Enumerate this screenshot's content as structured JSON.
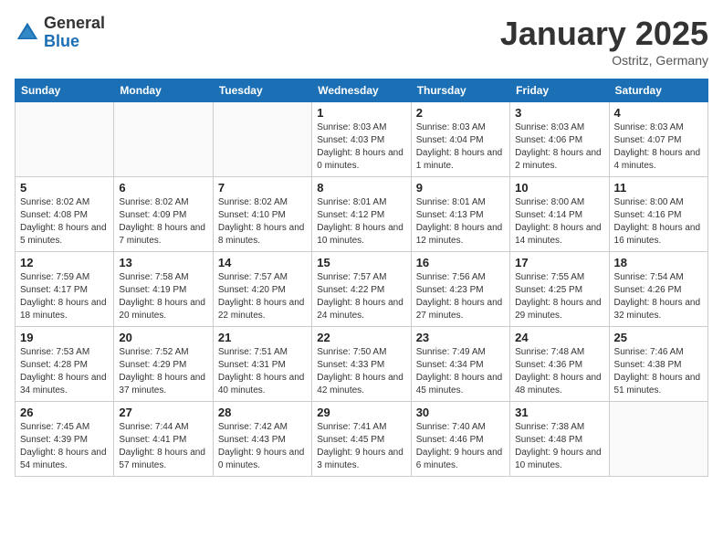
{
  "header": {
    "logo_general": "General",
    "logo_blue": "Blue",
    "month": "January 2025",
    "location": "Ostritz, Germany"
  },
  "weekdays": [
    "Sunday",
    "Monday",
    "Tuesday",
    "Wednesday",
    "Thursday",
    "Friday",
    "Saturday"
  ],
  "weeks": [
    [
      {
        "day": "",
        "info": ""
      },
      {
        "day": "",
        "info": ""
      },
      {
        "day": "",
        "info": ""
      },
      {
        "day": "1",
        "info": "Sunrise: 8:03 AM\nSunset: 4:03 PM\nDaylight: 8 hours\nand 0 minutes."
      },
      {
        "day": "2",
        "info": "Sunrise: 8:03 AM\nSunset: 4:04 PM\nDaylight: 8 hours\nand 1 minute."
      },
      {
        "day": "3",
        "info": "Sunrise: 8:03 AM\nSunset: 4:06 PM\nDaylight: 8 hours\nand 2 minutes."
      },
      {
        "day": "4",
        "info": "Sunrise: 8:03 AM\nSunset: 4:07 PM\nDaylight: 8 hours\nand 4 minutes."
      }
    ],
    [
      {
        "day": "5",
        "info": "Sunrise: 8:02 AM\nSunset: 4:08 PM\nDaylight: 8 hours\nand 5 minutes."
      },
      {
        "day": "6",
        "info": "Sunrise: 8:02 AM\nSunset: 4:09 PM\nDaylight: 8 hours\nand 7 minutes."
      },
      {
        "day": "7",
        "info": "Sunrise: 8:02 AM\nSunset: 4:10 PM\nDaylight: 8 hours\nand 8 minutes."
      },
      {
        "day": "8",
        "info": "Sunrise: 8:01 AM\nSunset: 4:12 PM\nDaylight: 8 hours\nand 10 minutes."
      },
      {
        "day": "9",
        "info": "Sunrise: 8:01 AM\nSunset: 4:13 PM\nDaylight: 8 hours\nand 12 minutes."
      },
      {
        "day": "10",
        "info": "Sunrise: 8:00 AM\nSunset: 4:14 PM\nDaylight: 8 hours\nand 14 minutes."
      },
      {
        "day": "11",
        "info": "Sunrise: 8:00 AM\nSunset: 4:16 PM\nDaylight: 8 hours\nand 16 minutes."
      }
    ],
    [
      {
        "day": "12",
        "info": "Sunrise: 7:59 AM\nSunset: 4:17 PM\nDaylight: 8 hours\nand 18 minutes."
      },
      {
        "day": "13",
        "info": "Sunrise: 7:58 AM\nSunset: 4:19 PM\nDaylight: 8 hours\nand 20 minutes."
      },
      {
        "day": "14",
        "info": "Sunrise: 7:57 AM\nSunset: 4:20 PM\nDaylight: 8 hours\nand 22 minutes."
      },
      {
        "day": "15",
        "info": "Sunrise: 7:57 AM\nSunset: 4:22 PM\nDaylight: 8 hours\nand 24 minutes."
      },
      {
        "day": "16",
        "info": "Sunrise: 7:56 AM\nSunset: 4:23 PM\nDaylight: 8 hours\nand 27 minutes."
      },
      {
        "day": "17",
        "info": "Sunrise: 7:55 AM\nSunset: 4:25 PM\nDaylight: 8 hours\nand 29 minutes."
      },
      {
        "day": "18",
        "info": "Sunrise: 7:54 AM\nSunset: 4:26 PM\nDaylight: 8 hours\nand 32 minutes."
      }
    ],
    [
      {
        "day": "19",
        "info": "Sunrise: 7:53 AM\nSunset: 4:28 PM\nDaylight: 8 hours\nand 34 minutes."
      },
      {
        "day": "20",
        "info": "Sunrise: 7:52 AM\nSunset: 4:29 PM\nDaylight: 8 hours\nand 37 minutes."
      },
      {
        "day": "21",
        "info": "Sunrise: 7:51 AM\nSunset: 4:31 PM\nDaylight: 8 hours\nand 40 minutes."
      },
      {
        "day": "22",
        "info": "Sunrise: 7:50 AM\nSunset: 4:33 PM\nDaylight: 8 hours\nand 42 minutes."
      },
      {
        "day": "23",
        "info": "Sunrise: 7:49 AM\nSunset: 4:34 PM\nDaylight: 8 hours\nand 45 minutes."
      },
      {
        "day": "24",
        "info": "Sunrise: 7:48 AM\nSunset: 4:36 PM\nDaylight: 8 hours\nand 48 minutes."
      },
      {
        "day": "25",
        "info": "Sunrise: 7:46 AM\nSunset: 4:38 PM\nDaylight: 8 hours\nand 51 minutes."
      }
    ],
    [
      {
        "day": "26",
        "info": "Sunrise: 7:45 AM\nSunset: 4:39 PM\nDaylight: 8 hours\nand 54 minutes."
      },
      {
        "day": "27",
        "info": "Sunrise: 7:44 AM\nSunset: 4:41 PM\nDaylight: 8 hours\nand 57 minutes."
      },
      {
        "day": "28",
        "info": "Sunrise: 7:42 AM\nSunset: 4:43 PM\nDaylight: 9 hours\nand 0 minutes."
      },
      {
        "day": "29",
        "info": "Sunrise: 7:41 AM\nSunset: 4:45 PM\nDaylight: 9 hours\nand 3 minutes."
      },
      {
        "day": "30",
        "info": "Sunrise: 7:40 AM\nSunset: 4:46 PM\nDaylight: 9 hours\nand 6 minutes."
      },
      {
        "day": "31",
        "info": "Sunrise: 7:38 AM\nSunset: 4:48 PM\nDaylight: 9 hours\nand 10 minutes."
      },
      {
        "day": "",
        "info": ""
      }
    ]
  ]
}
